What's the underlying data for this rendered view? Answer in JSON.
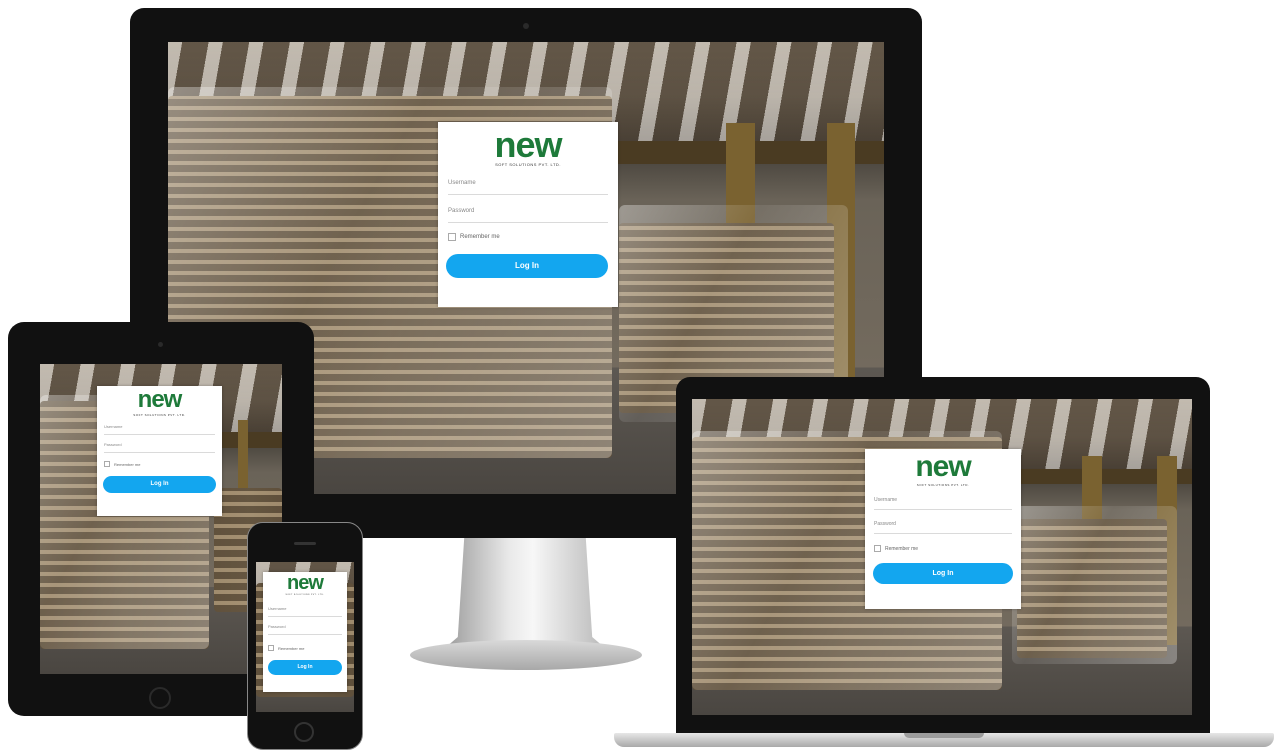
{
  "login": {
    "brand": "new",
    "tagline": "SOFT SOLUTIONS PVT. LTD.",
    "username_placeholder": "Username",
    "password_placeholder": "Password",
    "remember_label": "Remember me",
    "login_button": "Log In"
  },
  "colors": {
    "brand_green": "#1e7a3a",
    "brand_lime": "#8cc63f",
    "button_blue": "#13a6ef",
    "bezel": "#0d0d0d"
  },
  "devices": [
    "desktop-monitor",
    "tablet",
    "phone",
    "laptop"
  ]
}
